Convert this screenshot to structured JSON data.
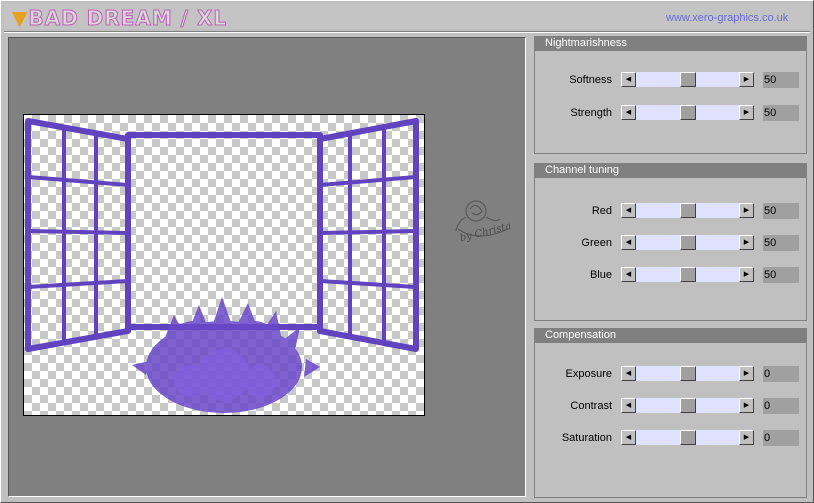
{
  "header": {
    "logo_text": "BAD DREAM / XL",
    "logo_mark": "▼",
    "url": "www.xero-graphics.co.uk"
  },
  "watermark": {
    "text": "by Christa"
  },
  "panels": [
    {
      "title": "Nightmarishness",
      "sliders": [
        {
          "label": "Softness",
          "value": "50",
          "fraction": 0.5
        },
        {
          "label": "Strength",
          "value": "50",
          "fraction": 0.5
        }
      ]
    },
    {
      "title": "Channel tuning",
      "sliders": [
        {
          "label": "Red",
          "value": "50",
          "fraction": 0.5
        },
        {
          "label": "Green",
          "value": "50",
          "fraction": 0.5
        },
        {
          "label": "Blue",
          "value": "50",
          "fraction": 0.5
        }
      ]
    },
    {
      "title": "Compensation",
      "sliders": [
        {
          "label": "Exposure",
          "value": "0",
          "fraction": 0.5
        },
        {
          "label": "Contrast",
          "value": "0",
          "fraction": 0.5
        },
        {
          "label": "Saturation",
          "value": "0",
          "fraction": 0.5
        }
      ]
    }
  ],
  "colors": {
    "window_frame": "#5a3bbd",
    "slider_track": "#e0e0ff",
    "panel_header": "#808080",
    "url_text": "#6a6ad8"
  }
}
